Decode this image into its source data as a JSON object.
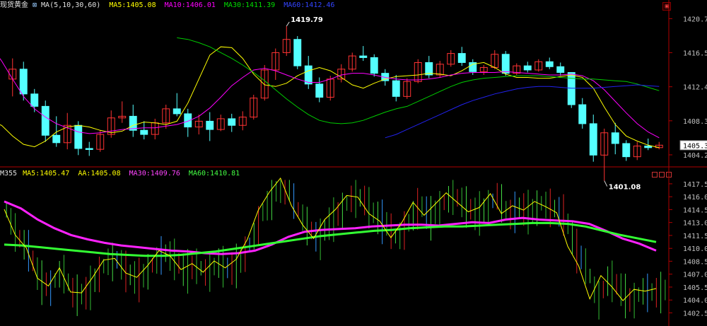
{
  "top_panel": {
    "name": "现货黄金",
    "ma_params": "MA(5,10,30,60)",
    "ma5": "MA5:1405.08",
    "ma10": "MA10:1406.01",
    "ma30": "MA30:1411.39",
    "ma60": "MA60:1412.46",
    "high_label": "1419.79",
    "low_label": "1401.08",
    "current_price": "1405.35"
  },
  "bottom_panel": {
    "name": "M355",
    "ma5": "MA5:1405.47",
    "aa": "AA:1405.08",
    "ma30": "MA30:1409.76",
    "ma60": "MA60:1410.81"
  },
  "colors": {
    "up": "#ff3333",
    "down": "#54ffff",
    "ma5": "#ffff00",
    "ma10": "#ff00ff",
    "ma30": "#00cc00",
    "ma60": "#2222ee",
    "axis": "#b00000",
    "tick_text": "#c0c0c0"
  },
  "chart_data": [
    {
      "type": "candlestick",
      "title": "现货黄金",
      "ylim": [
        1403.2,
        1421.6
      ],
      "y_ticks": [
        "1420.71",
        "1416.59",
        "1412.47",
        "1408.35",
        "1404.23"
      ],
      "y_tick_values": [
        1420.71,
        1416.59,
        1412.47,
        1408.35,
        1404.23
      ],
      "series": [
        {
          "name": "MA5",
          "values": [
            1416.2,
            1413.8,
            1411.2,
            1409.4,
            1408.3,
            1407.8,
            1406.5,
            1405.5,
            1405.2,
            1405.9,
            1407.0,
            1407.6,
            1407.8,
            1407.6,
            1407.2,
            1406.9,
            1407.1,
            1407.8,
            1408.2,
            1408.1,
            1407.9,
            1408.3,
            1410.5,
            1413.4,
            1416.3,
            1417.3,
            1417.2,
            1415.9,
            1414.0,
            1412.7,
            1412.5,
            1412.9,
            1413.8,
            1414.4,
            1414.8,
            1414.4,
            1413.6,
            1412.7,
            1412.3,
            1412.9,
            1413.4,
            1413.7,
            1413.8,
            1413.9,
            1414.1,
            1414.0,
            1413.8,
            1414.4,
            1415.2,
            1415.4,
            1414.8,
            1414.0,
            1413.6,
            1413.6,
            1413.5,
            1413.5,
            1413.7,
            1413.9,
            1413.6,
            1412.3,
            1410.0,
            1407.9,
            1406.5,
            1405.9,
            1405.4,
            1405.1
          ]
        },
        {
          "name": "MA10",
          "values": [
            1418.5,
            1417.4,
            1415.6,
            1413.4,
            1411.3,
            1409.8,
            1408.8,
            1408.0,
            1407.5,
            1407.0,
            1406.8,
            1406.9,
            1407.1,
            1407.3,
            1407.4,
            1407.5,
            1407.5,
            1407.7,
            1407.9,
            1408.3,
            1408.9,
            1409.9,
            1411.2,
            1412.6,
            1413.6,
            1414.5,
            1414.7,
            1414.4,
            1413.9,
            1413.4,
            1413.0,
            1413.0,
            1413.4,
            1413.9,
            1414.1,
            1414.1,
            1413.9,
            1413.6,
            1413.4,
            1413.3,
            1413.3,
            1413.4,
            1413.6,
            1413.9,
            1414.1,
            1414.2,
            1414.2,
            1414.2,
            1414.3,
            1414.2,
            1414.1,
            1414.0,
            1413.9,
            1413.9,
            1414.0,
            1413.8,
            1413.2,
            1412.1,
            1410.7,
            1409.3,
            1408.0,
            1407.0,
            1406.3
          ]
        },
        {
          "name": "MA30",
          "values": [
            1418.4,
            1418.2,
            1417.8,
            1417.3,
            1416.6,
            1415.9,
            1415.1,
            1414.2,
            1413.2,
            1412.1,
            1411.0,
            1410.0,
            1409.1,
            1408.4,
            1408.1,
            1408.0,
            1408.1,
            1408.4,
            1408.9,
            1409.4,
            1409.8,
            1410.1,
            1410.7,
            1411.3,
            1411.9,
            1412.5,
            1413.0,
            1413.3,
            1413.5,
            1413.6,
            1413.7,
            1413.8,
            1413.8,
            1413.8,
            1413.7,
            1413.6,
            1413.5,
            1413.4,
            1413.4,
            1413.3,
            1413.2,
            1413.1,
            1412.8,
            1412.4,
            1412.0
          ]
        },
        {
          "name": "MA60",
          "values": [
            1406.3,
            1406.7,
            1407.3,
            1407.9,
            1408.5,
            1409.1,
            1409.7,
            1410.3,
            1410.8,
            1411.2,
            1411.6,
            1411.9,
            1412.2,
            1412.4,
            1412.5,
            1412.5,
            1412.4,
            1412.3,
            1412.3,
            1412.3,
            1412.4,
            1412.5,
            1412.6,
            1412.7,
            1412.6,
            1412.5
          ]
        }
      ],
      "candles_ohlc": [
        [
          1413.4,
          1415.9,
          1411.3,
          1414.6
        ],
        [
          1414.6,
          1415.5,
          1410.8,
          1411.6
        ],
        [
          1411.6,
          1412.2,
          1409.4,
          1410.1
        ],
        [
          1410.1,
          1410.8,
          1405.8,
          1406.6
        ],
        [
          1406.6,
          1408.9,
          1405.2,
          1405.7
        ],
        [
          1405.7,
          1409.3,
          1404.9,
          1407.8
        ],
        [
          1407.8,
          1408.3,
          1404.2,
          1405.0
        ],
        [
          1405.0,
          1405.8,
          1404.1,
          1404.9
        ],
        [
          1404.9,
          1407.2,
          1404.6,
          1406.7
        ],
        [
          1406.7,
          1409.6,
          1406.3,
          1408.7
        ],
        [
          1408.7,
          1410.7,
          1408.1,
          1408.9
        ],
        [
          1408.9,
          1410.3,
          1406.4,
          1407.2
        ],
        [
          1407.2,
          1408.3,
          1406.1,
          1406.7
        ],
        [
          1406.7,
          1408.6,
          1406.1,
          1408.1
        ],
        [
          1408.1,
          1410.3,
          1407.4,
          1409.8
        ],
        [
          1409.8,
          1411.7,
          1408.9,
          1409.2
        ],
        [
          1409.2,
          1409.8,
          1406.4,
          1407.6
        ],
        [
          1407.6,
          1409.1,
          1406.7,
          1408.3
        ],
        [
          1408.3,
          1409.4,
          1405.9,
          1407.3
        ],
        [
          1407.3,
          1409.1,
          1407.1,
          1408.6
        ],
        [
          1408.6,
          1409.2,
          1407.0,
          1407.8
        ],
        [
          1407.8,
          1409.5,
          1407.2,
          1408.8
        ],
        [
          1408.8,
          1411.5,
          1408.5,
          1411.1
        ],
        [
          1411.1,
          1415.1,
          1410.8,
          1414.5
        ],
        [
          1414.5,
          1417.1,
          1413.3,
          1416.6
        ],
        [
          1416.6,
          1419.8,
          1416.2,
          1418.2
        ],
        [
          1418.2,
          1418.6,
          1414.6,
          1415.0
        ],
        [
          1415.0,
          1416.2,
          1412.2,
          1412.8
        ],
        [
          1412.8,
          1413.6,
          1410.6,
          1411.2
        ],
        [
          1411.2,
          1413.8,
          1410.8,
          1413.4
        ],
        [
          1413.4,
          1415.2,
          1413.0,
          1414.6
        ],
        [
          1414.6,
          1416.6,
          1414.3,
          1416.2
        ],
        [
          1416.2,
          1417.4,
          1415.6,
          1416.0
        ],
        [
          1416.0,
          1416.4,
          1413.7,
          1414.1
        ],
        [
          1414.1,
          1414.6,
          1412.6,
          1413.2
        ],
        [
          1413.2,
          1413.9,
          1410.7,
          1411.3
        ],
        [
          1411.3,
          1413.5,
          1411.0,
          1413.1
        ],
        [
          1413.1,
          1415.8,
          1412.9,
          1415.4
        ],
        [
          1415.4,
          1416.2,
          1413.5,
          1413.9
        ],
        [
          1413.9,
          1415.6,
          1413.6,
          1415.2
        ],
        [
          1415.2,
          1416.9,
          1414.9,
          1416.5
        ],
        [
          1416.5,
          1417.3,
          1415.0,
          1415.4
        ],
        [
          1415.4,
          1415.8,
          1413.9,
          1414.3
        ],
        [
          1414.3,
          1415.1,
          1413.9,
          1414.8
        ],
        [
          1414.8,
          1416.9,
          1414.6,
          1416.4
        ],
        [
          1416.4,
          1416.8,
          1413.8,
          1414.1
        ],
        [
          1414.1,
          1415.3,
          1413.9,
          1415.0
        ],
        [
          1415.0,
          1415.5,
          1414.2,
          1414.5
        ],
        [
          1414.5,
          1415.8,
          1414.3,
          1415.5
        ],
        [
          1415.5,
          1416.0,
          1414.6,
          1414.9
        ],
        [
          1414.9,
          1415.4,
          1413.8,
          1414.2
        ],
        [
          1414.2,
          1412.5,
          1409.9,
          1410.3
        ],
        [
          1410.3,
          1411.1,
          1407.4,
          1408.0
        ],
        [
          1408.0,
          1409.1,
          1403.4,
          1404.2
        ],
        [
          1404.2,
          1407.4,
          1401.1,
          1406.9
        ],
        [
          1406.9,
          1408.1,
          1404.3,
          1405.6
        ],
        [
          1405.6,
          1406.0,
          1403.5,
          1404.0
        ],
        [
          1404.0,
          1405.8,
          1403.6,
          1405.3
        ],
        [
          1405.3,
          1406.2,
          1404.8,
          1405.1
        ],
        [
          1405.1,
          1405.8,
          1404.9,
          1405.4
        ]
      ]
    },
    {
      "type": "candlestick",
      "title": "M355",
      "ylim": [
        1401.3,
        1418.2
      ],
      "y_ticks": [
        "1417.55",
        "1416.05",
        "1414.56",
        "1413.06",
        "1411.56",
        "1410.06",
        "1408.57",
        "1407.07",
        "1405.57",
        "1404.07",
        "1402.58"
      ],
      "y_tick_values": [
        1417.55,
        1416.05,
        1414.56,
        1413.06,
        1411.56,
        1410.06,
        1408.57,
        1407.07,
        1405.57,
        1404.07,
        1402.58
      ],
      "series": [
        {
          "name": "MA30",
          "values": [
            1415.5,
            1414.7,
            1413.4,
            1412.4,
            1411.6,
            1411.1,
            1410.7,
            1410.4,
            1410.2,
            1410.0,
            1409.8,
            1409.7,
            1409.5,
            1409.4,
            1409.5,
            1409.8,
            1410.5,
            1411.4,
            1412.0,
            1412.2,
            1412.3,
            1412.4,
            1412.6,
            1412.7,
            1412.8,
            1412.8,
            1412.7,
            1412.9,
            1413.1,
            1413.0,
            1413.4,
            1413.6,
            1413.4,
            1413.3,
            1413.2,
            1412.9,
            1412.1,
            1411.2,
            1410.6,
            1409.8
          ]
        },
        {
          "name": "MA60",
          "values": [
            1410.5,
            1410.4,
            1410.2,
            1410.0,
            1409.8,
            1409.6,
            1409.4,
            1409.3,
            1409.2,
            1409.2,
            1409.3,
            1409.5,
            1409.7,
            1410.0,
            1410.3,
            1410.6,
            1410.9,
            1411.2,
            1411.5,
            1411.7,
            1411.9,
            1412.1,
            1412.2,
            1412.4,
            1412.5,
            1412.6,
            1412.6,
            1412.7,
            1412.8,
            1412.9,
            1413.0,
            1413.0,
            1412.9,
            1412.6,
            1412.1,
            1411.6,
            1411.2,
            1410.8
          ]
        }
      ]
    }
  ]
}
